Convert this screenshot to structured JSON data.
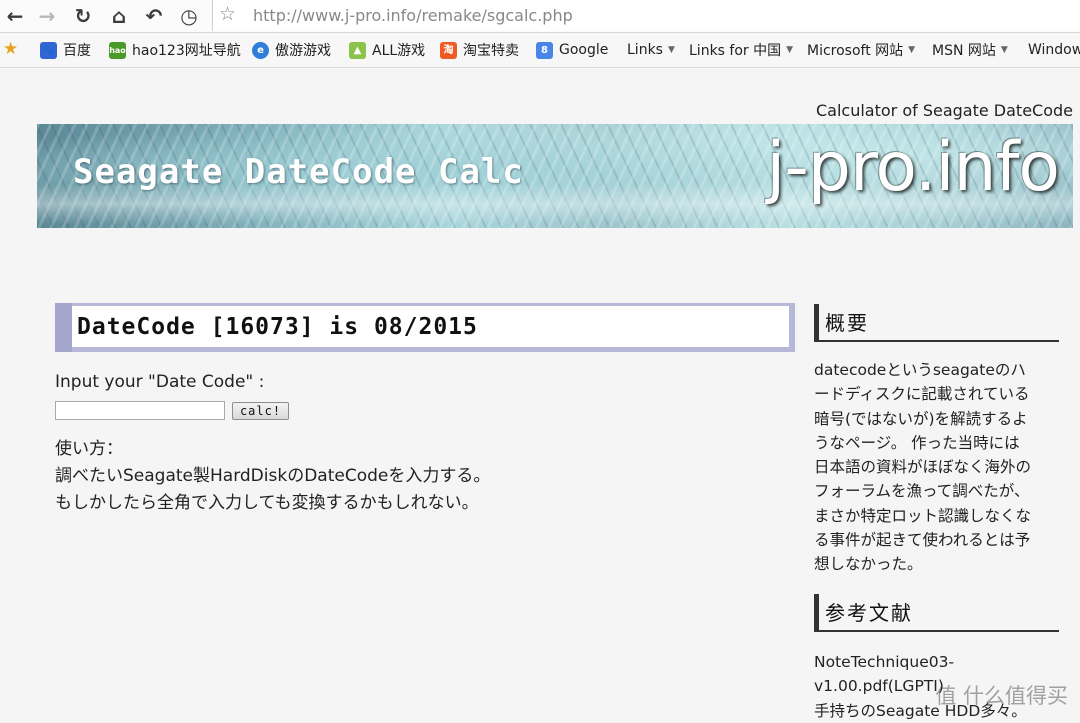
{
  "browser": {
    "url": "http://www.j-pro.info/remake/sgcalc.php",
    "bookmarks": [
      {
        "label": "百度",
        "icon": "baidu-icon",
        "color": "#2f66d4"
      },
      {
        "label": "hao123网址导航",
        "icon": "hao123-icon",
        "color": "#4a9a2a"
      },
      {
        "label": "傲游游戏",
        "icon": "maxthon-game-icon",
        "color": "#2f7fd8"
      },
      {
        "label": "ALL游戏",
        "icon": "all-game-icon",
        "color": "#8bc34a"
      },
      {
        "label": "淘宝特卖",
        "icon": "taobao-icon",
        "color": "#f05a24"
      },
      {
        "label": "Google",
        "icon": "google-icon",
        "color": "#4a86e8"
      },
      {
        "label": "Links"
      },
      {
        "label": "Links for 中国"
      },
      {
        "label": "Microsoft 网站"
      },
      {
        "label": "MSN 网站"
      },
      {
        "label": "Window"
      }
    ],
    "icon_glyphs": {
      "hao123": "hao",
      "ie": "e",
      "taobao": "淘",
      "google": "8"
    }
  },
  "page": {
    "subtitle": "Calculator of Seagate DateCode",
    "banner_title": "Seagate DateCode Calc",
    "banner_logo": "j-pro.info",
    "result": "DateCode [16073] is 08/2015",
    "input_label": "Input your \"Date Code\" :",
    "input_value": "",
    "button_label": "calc!",
    "usage": [
      "使い方：",
      "調べたいSeagate製HardDiskのDateCodeを入力する。",
      "もしかしたら全角で入力しても変換するかもしれない。"
    ]
  },
  "sidebar": {
    "overview_heading": "概要",
    "overview_lines": [
      "datecodeというseagateのハ",
      "ードディスクに記載されている",
      "暗号(ではないが)を解読するよ",
      "うなページ。 作った当時には",
      "日本語の資料がほぼなく海外の",
      "フォーラムを漁って調べたが、",
      "まさか特定ロット認識しなくな",
      "る事件が起きて使われるとは予",
      "想しなかった。"
    ],
    "refs_heading": "参考文献",
    "refs_lines": [
      "NoteTechnique03-",
      "v1.00.pdf(LGPTI)",
      "手持ちのSeagate HDD多々。"
    ]
  },
  "watermark": "值 什么值得买"
}
